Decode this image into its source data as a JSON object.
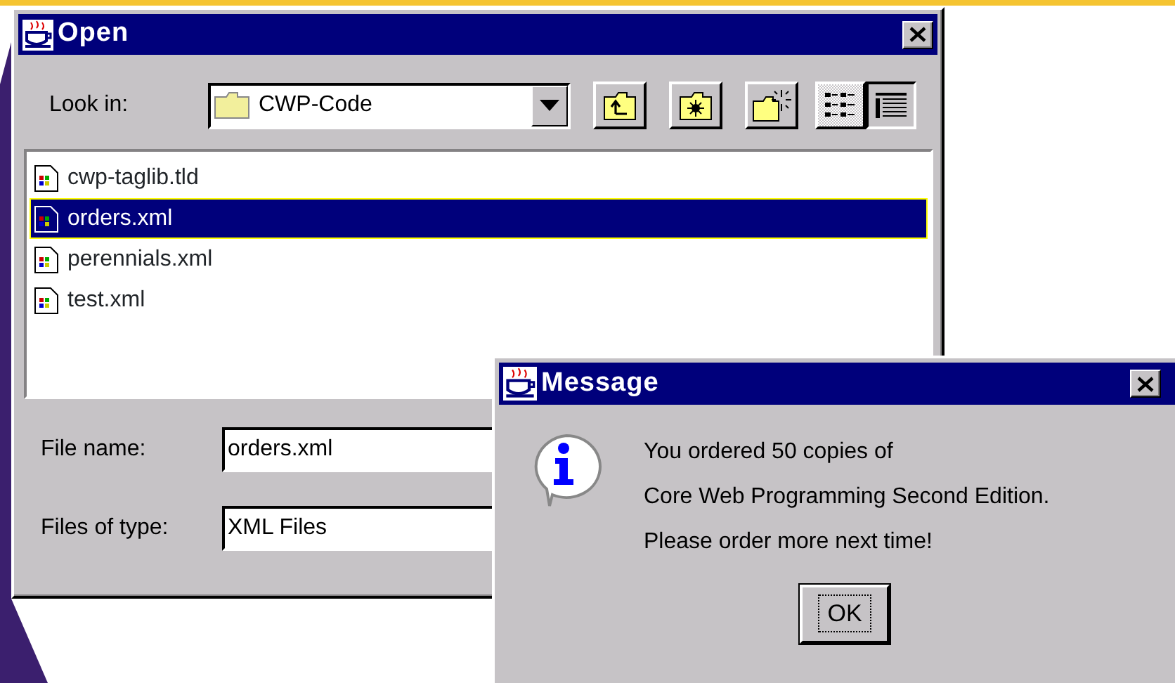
{
  "open_dialog": {
    "title": "Open",
    "look_in": {
      "label": "Look in:",
      "value": "CWP-Code"
    },
    "view_toggles": [
      {
        "kind": "list",
        "selected": true
      },
      {
        "kind": "details",
        "selected": false
      }
    ],
    "files": [
      {
        "name": "cwp-taglib.tld",
        "selected": false
      },
      {
        "name": "orders.xml",
        "selected": true
      },
      {
        "name": "perennials.xml",
        "selected": false
      },
      {
        "name": "test.xml",
        "selected": false
      }
    ],
    "file_name": {
      "label": "File name:",
      "value": "orders.xml"
    },
    "file_type": {
      "label": "Files of type:",
      "value": "XML Files"
    }
  },
  "message_dialog": {
    "title": "Message",
    "lines": [
      "You ordered 50 copies of",
      "Core Web Programming Second Edition.",
      "Please order more next time!"
    ],
    "button": "OK"
  }
}
